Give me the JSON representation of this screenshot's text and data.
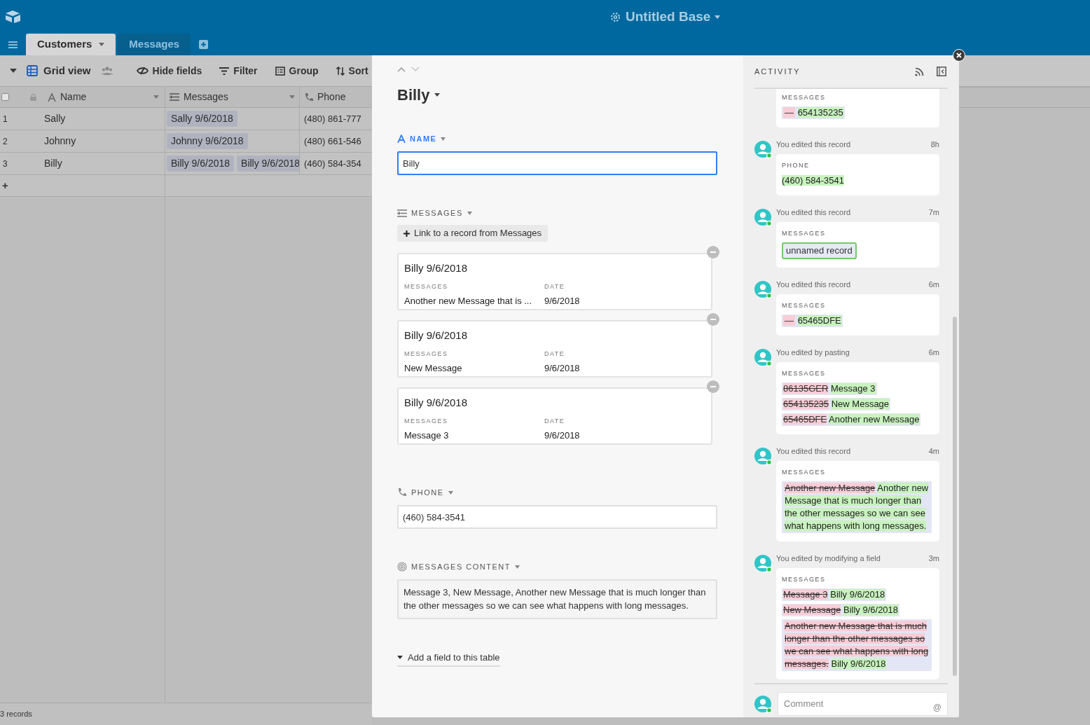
{
  "app": {
    "title": "Untitled Base"
  },
  "tables": [
    {
      "label": "Customers",
      "selected": true
    },
    {
      "label": "Messages",
      "selected": false
    }
  ],
  "toolbar": {
    "view": "Grid view",
    "buttons": [
      {
        "kind": "hide",
        "label": "Hide fields"
      },
      {
        "kind": "filter",
        "label": "Filter"
      },
      {
        "kind": "group",
        "label": "Group"
      },
      {
        "kind": "sort",
        "label": "Sort"
      }
    ]
  },
  "grid": {
    "columns": [
      {
        "kind": "name",
        "label": "Name"
      },
      {
        "kind": "link",
        "label": "Messages"
      },
      {
        "kind": "phone",
        "label": "Phone"
      }
    ],
    "rows": [
      {
        "number": "1",
        "name": "Sally",
        "messages": [
          "Sally 9/6/2018"
        ],
        "phone": "(480) 861-777"
      },
      {
        "number": "2",
        "name": "Johnny",
        "messages": [
          "Johnny 9/6/2018"
        ],
        "phone": "(480) 661-546"
      },
      {
        "number": "3",
        "name": "Billy",
        "messages": [
          "Billy 9/6/2018",
          "Billy 9/6/2018"
        ],
        "phone": "(460) 584-354"
      }
    ],
    "select_all_checked": false,
    "add_row": "+",
    "footer": "3 records"
  },
  "record": {
    "title": "Billy",
    "fields": [
      {
        "kind": "text",
        "label": "NAME",
        "active": true,
        "value": "Billy"
      },
      {
        "kind": "link",
        "label": "MESSAGES",
        "active": false,
        "button": "Link to a record from Messages",
        "records": [
          {
            "title": "Billy 9/6/2018",
            "columns": [
              {
                "label": "MESSAGES",
                "value": "Another new Message that is ..."
              },
              {
                "label": "DATE",
                "value": "9/6/2018"
              }
            ]
          },
          {
            "title": "Billy 9/6/2018",
            "columns": [
              {
                "label": "MESSAGES",
                "value": "New Message"
              },
              {
                "label": "DATE",
                "value": "9/6/2018"
              }
            ]
          },
          {
            "title": "Billy 9/6/2018",
            "columns": [
              {
                "label": "MESSAGES",
                "value": "Message 3"
              },
              {
                "label": "DATE",
                "value": "9/6/2018"
              }
            ]
          }
        ]
      },
      {
        "kind": "phone",
        "label": "PHONE",
        "active": false,
        "value": "(460) 584-3541"
      },
      {
        "kind": "lookup",
        "label": "MESSAGES CONTENT",
        "active": false,
        "value": "Message 3, New Message, Another new Message that is much longer than the other messages so we can see what happens with long messages."
      }
    ],
    "add_field": "Add a field to this table"
  },
  "activity": {
    "title": "ACTIVITY",
    "entries": [
      {
        "field": "MESSAGES",
        "lines": [
          {
            "kind": "diff",
            "parts": [
              {
                "kind": "empty",
                "text": "—"
              },
              {
                "kind": "added",
                "text": "654135235"
              }
            ]
          }
        ]
      },
      {
        "summary": "You edited this record",
        "time": "8h",
        "field": "PHONE",
        "lines": [
          {
            "kind": "plain",
            "parts": [
              {
                "kind": "added",
                "text": "(460) 584-3541"
              }
            ]
          }
        ]
      },
      {
        "summary": "You edited this record",
        "time": "7m",
        "field": "MESSAGES",
        "lines": [
          {
            "kind": "plain",
            "parts": [
              {
                "kind": "linked",
                "text": "unnamed record"
              }
            ]
          }
        ]
      },
      {
        "summary": "You edited this record",
        "time": "6m",
        "field": "MESSAGES",
        "lines": [
          {
            "kind": "diff",
            "parts": [
              {
                "kind": "empty",
                "text": "—"
              },
              {
                "kind": "added",
                "text": "65465DFE"
              }
            ]
          }
        ]
      },
      {
        "summary": "You edited by pasting",
        "time": "6m",
        "field": "MESSAGES",
        "lines": [
          {
            "kind": "diff",
            "parts": [
              {
                "kind": "removed",
                "text": "86135GER"
              },
              {
                "kind": "added",
                "text": "Message 3"
              }
            ]
          },
          {
            "kind": "diff",
            "parts": [
              {
                "kind": "removed",
                "text": "654135235"
              },
              {
                "kind": "added",
                "text": "New Message"
              }
            ]
          },
          {
            "kind": "diff",
            "parts": [
              {
                "kind": "removed",
                "text": "65465DFE"
              },
              {
                "kind": "added",
                "text": "Another new Message"
              }
            ]
          }
        ]
      },
      {
        "summary": "You edited this record",
        "time": "4m",
        "field": "MESSAGES",
        "lines": [
          {
            "kind": "block",
            "parts": [
              {
                "kind": "removed",
                "text": "Another new Message"
              },
              {
                "kind": "added",
                "text": "Another new Message that is much longer than the other messages so we can see what happens with long messages."
              }
            ]
          }
        ]
      },
      {
        "summary": "You edited by modifying a field",
        "time": "3m",
        "field": "MESSAGES",
        "lines": [
          {
            "kind": "diff",
            "parts": [
              {
                "kind": "removed",
                "text": "Message 3"
              },
              {
                "kind": "added",
                "text": "Billy 9/6/2018"
              }
            ]
          },
          {
            "kind": "diff",
            "parts": [
              {
                "kind": "removed",
                "text": "New Message"
              },
              {
                "kind": "added",
                "text": "Billy 9/6/2018"
              }
            ]
          },
          {
            "kind": "block",
            "parts": [
              {
                "kind": "removed",
                "text": "Another new Message that is much longer than the other messages so we can see what happens with long messages."
              },
              {
                "kind": "added",
                "text": "Billy 9/6/2018"
              }
            ]
          }
        ]
      }
    ],
    "comment_placeholder": "Comment",
    "comment_mention": "@"
  }
}
